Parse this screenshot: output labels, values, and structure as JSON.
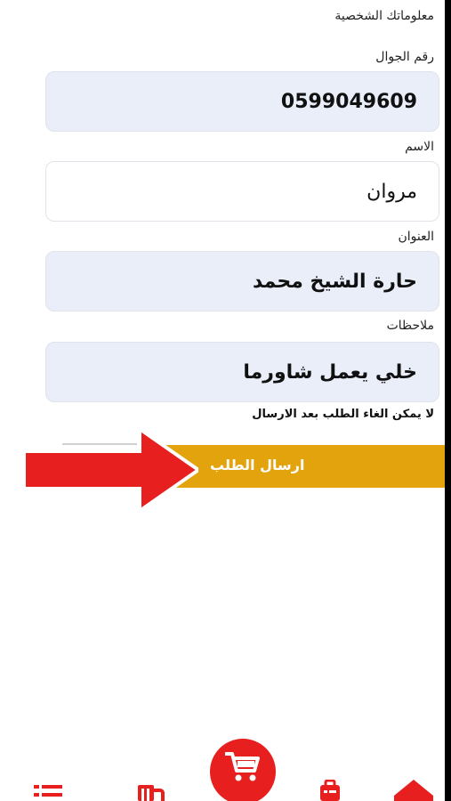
{
  "section_title": "معلوماتك الشخصية",
  "form": {
    "phone": {
      "label": "رقم الجوال",
      "value": "0599049609"
    },
    "name": {
      "label": "الاسم",
      "value": "مروان"
    },
    "address": {
      "label": "العنوان",
      "value": "حارة الشيخ محمد"
    },
    "notes": {
      "label": "ملاحظات",
      "value": "خلي يعمل شاورما"
    }
  },
  "warning": "لا يمكن الغاء الطلب بعد الارسال",
  "submit_label": "ارسال الطلب",
  "colors": {
    "accent": "#e3a30c",
    "brand_red": "#e81f1f",
    "field_bg": "#e9eef9"
  },
  "bottom_nav": {
    "icons": [
      "list-icon",
      "menu-icon",
      "cart-icon",
      "orders-icon",
      "home-icon"
    ]
  }
}
